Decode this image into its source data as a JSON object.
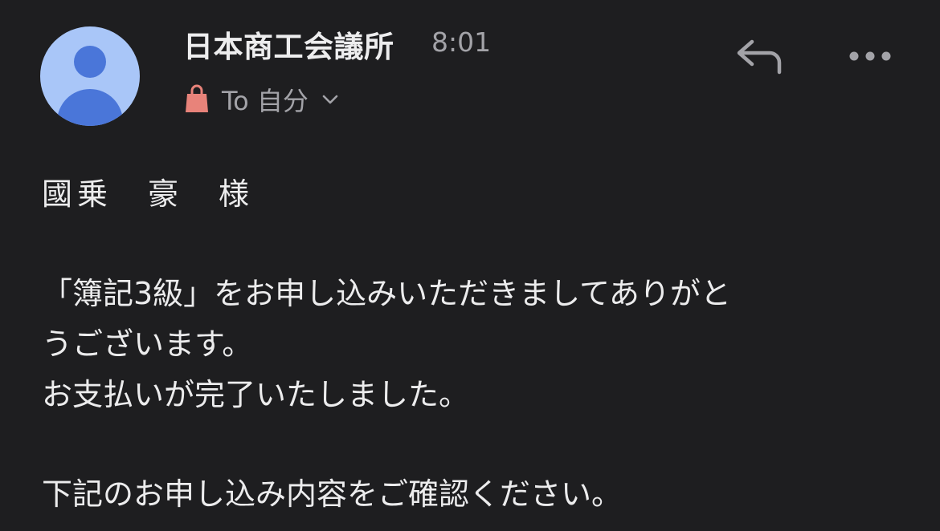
{
  "header": {
    "sender_name": "日本商工会議所",
    "time": "8:01",
    "recipient_label": "To 自分"
  },
  "icons": {
    "avatar": "person-avatar",
    "tag": "shopping-bag-icon",
    "reply": "reply-icon",
    "more": "more-horizontal-icon",
    "chevron": "chevron-down-icon"
  },
  "colors": {
    "background": "#1e1e20",
    "avatar_bg": "#a9c6f8",
    "avatar_fg": "#4a76d9",
    "tag_icon": "#e8837a",
    "secondary_text": "#a3a3a8",
    "primary_text": "#ececed"
  },
  "body": {
    "greeting": "國乗　豪　様",
    "line1": "「簿記3級」をお申し込みいただきましてありがと",
    "line2": "うございます。",
    "line3": "お支払いが完了いたしました。",
    "line4": "下記のお申し込み内容をご確認ください。"
  }
}
